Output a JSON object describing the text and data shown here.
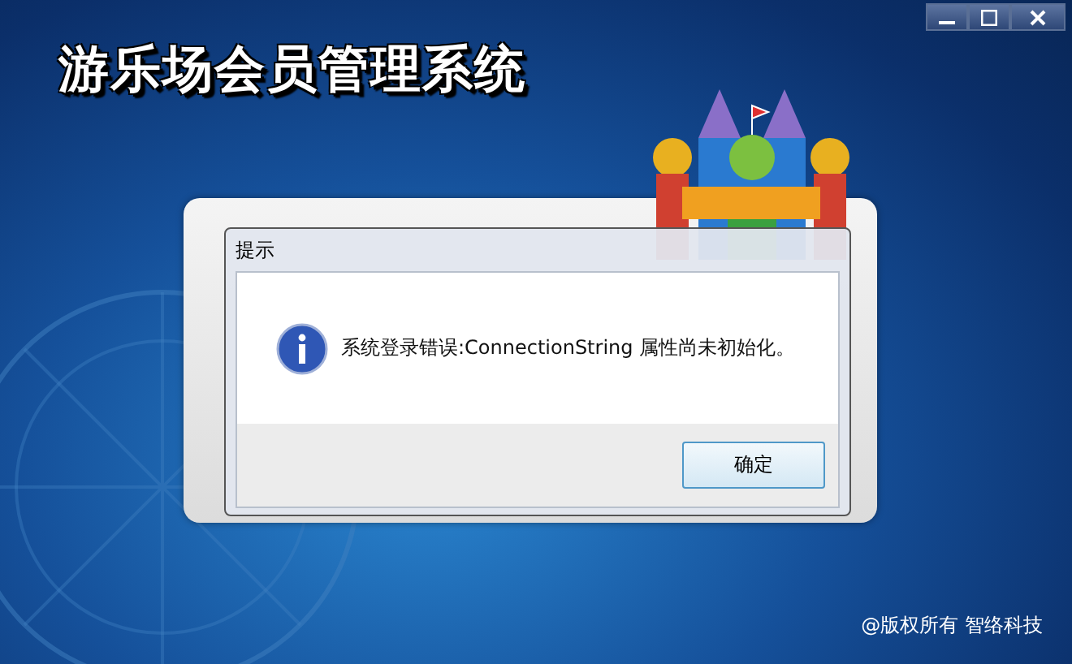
{
  "window": {
    "controls": [
      {
        "kind": "minimize"
      },
      {
        "kind": "maximize"
      },
      {
        "kind": "close"
      }
    ]
  },
  "app_title": "游乐场会员管理系统",
  "dialog": {
    "title": "提示",
    "message": "系统登录错误:ConnectionString 属性尚未初始化。",
    "buttons": [
      "确定"
    ]
  },
  "footer": "@版权所有 智络科技"
}
